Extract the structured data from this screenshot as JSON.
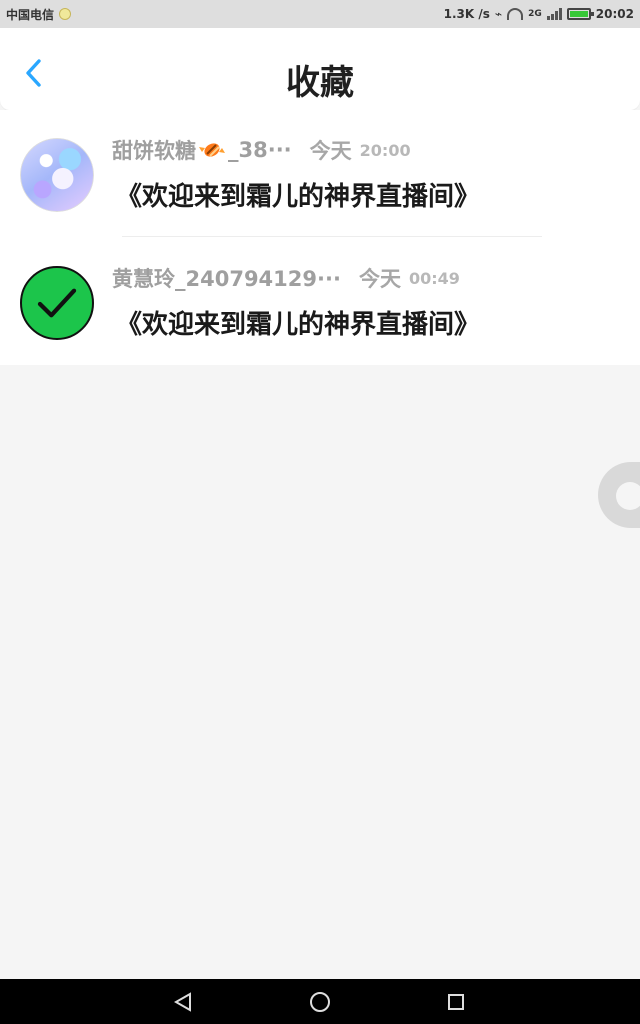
{
  "status_bar": {
    "carrier": "中国电信",
    "network_speed": "1.3K /s",
    "network_type": "2G",
    "time": "20:02"
  },
  "header": {
    "title": "收藏",
    "back_icon": "chevron-left-icon",
    "accent_color": "#2aa7ff"
  },
  "favorites": [
    {
      "author": "甜饼软糖",
      "author_suffix": "_38···",
      "date_label": "今天",
      "time": "20:00",
      "title": "《欢迎来到霜儿的神界直播间》",
      "avatar_icon": "anime-avatar-icon",
      "badge_icon": "candy-icon"
    },
    {
      "author": "黄慧玲_240794129···",
      "date_label": "今天",
      "time": "00:49",
      "title": "《欢迎来到霜儿的神界直播间》",
      "avatar_icon": "checkmark-icon",
      "avatar_color": "#1cc54b"
    }
  ],
  "navigation": {
    "back_icon": "triangle-back-icon",
    "home_icon": "circle-home-icon",
    "recent_icon": "square-recent-icon"
  }
}
